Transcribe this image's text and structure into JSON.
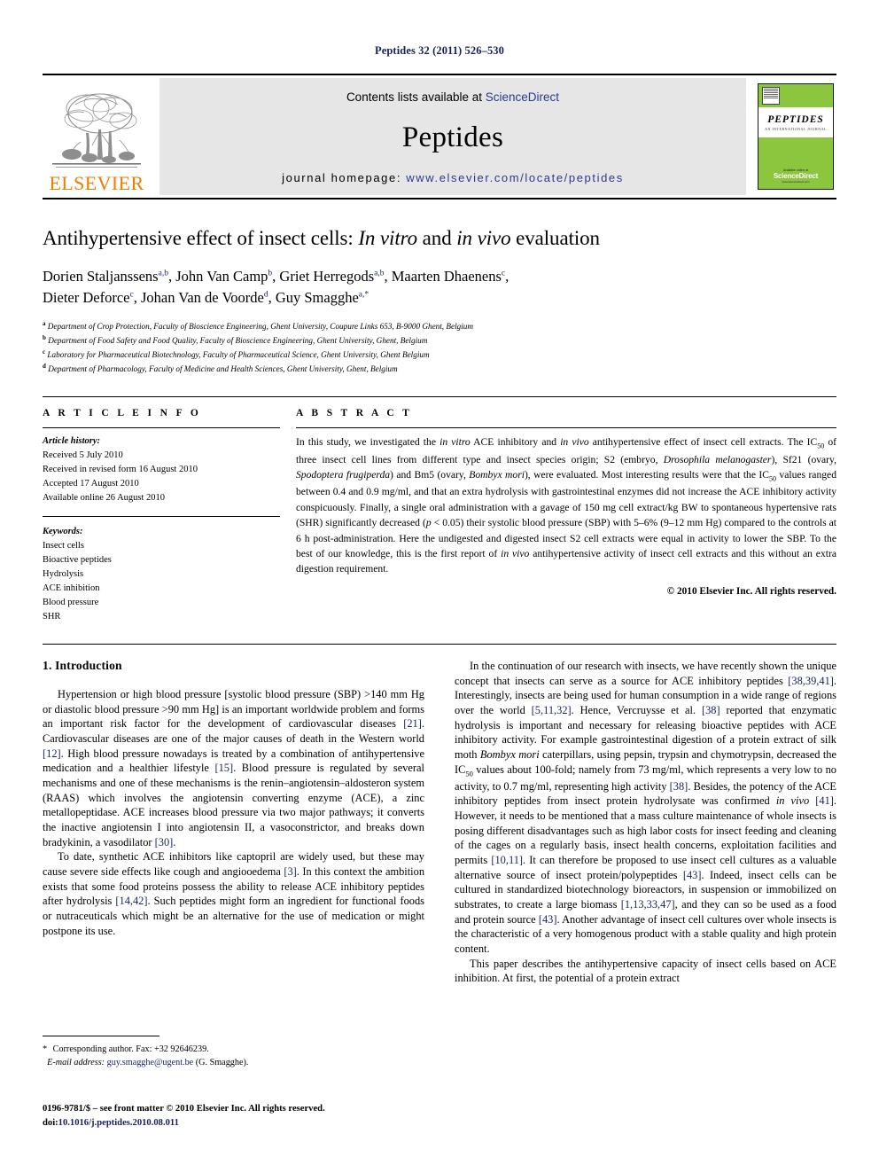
{
  "running_head": "Peptides 32 (2011) 526–530",
  "masthead": {
    "contents_prefix": "Contents lists available at ",
    "sciencedirect": "ScienceDirect",
    "journal_title": "Peptides",
    "homepage_prefix": "journal homepage: ",
    "homepage_url": "www.elsevier.com/locate/peptides",
    "publisher_wordmark": "ELSEVIER",
    "cover": {
      "name": "PEPTIDES",
      "subtitle": "AN INTERNATIONAL JOURNAL",
      "available_online": "Available online at",
      "sciencedirect": "ScienceDirect",
      "sd_tagline": "www.sciencedirect.com"
    },
    "colors": {
      "link": "#2b3a8c",
      "band": "#e6e6e6",
      "cover_green": "#8cc63e",
      "elsevier_orange": "#ef7d00"
    }
  },
  "article": {
    "title_part1": "Antihypertensive effect of insect cells: ",
    "title_italic1": "In vitro",
    "title_part2": " and ",
    "title_italic2": "in vivo",
    "title_part3": " evaluation",
    "authors_line1_a": "Dorien Staljanssens",
    "authors_line1_a_sup": "a,b",
    "authors_line1_b": ", John Van Camp",
    "authors_line1_b_sup": "b",
    "authors_line1_c": ", Griet Herregods",
    "authors_line1_c_sup": "a,b",
    "authors_line1_d": ", Maarten Dhaenens",
    "authors_line1_d_sup": "c",
    "authors_line1_end": ",",
    "authors_line2_a": "Dieter Deforce",
    "authors_line2_a_sup": "c",
    "authors_line2_b": ", Johan Van de Voorde",
    "authors_line2_b_sup": "d",
    "authors_line2_c": ", Guy Smagghe",
    "authors_line2_c_sup": "a,*",
    "affiliations": [
      {
        "mark": "a",
        "text": "Department of Crop Protection, Faculty of Bioscience Engineering, Ghent University, Coupure Links 653, B-9000 Ghent, Belgium"
      },
      {
        "mark": "b",
        "text": "Department of Food Safety and Food Quality, Faculty of Bioscience Engineering, Ghent University, Ghent, Belgium"
      },
      {
        "mark": "c",
        "text": "Laboratory for Pharmaceutical Biotechnology, Faculty of Pharmaceutical Science, Ghent University, Ghent Belgium"
      },
      {
        "mark": "d",
        "text": "Department of Pharmacology, Faculty of Medicine and Health Sciences, Ghent University, Ghent, Belgium"
      }
    ]
  },
  "info": {
    "heading": "A R T I C L E   I N F O",
    "history_label": "Article history:",
    "history": [
      "Received 5 July 2010",
      "Received in revised form 16 August 2010",
      "Accepted 17 August 2010",
      "Available online 26 August 2010"
    ],
    "keywords_label": "Keywords:",
    "keywords": [
      "Insect cells",
      "Bioactive peptides",
      "Hydrolysis",
      "ACE inhibition",
      "Blood pressure",
      "SHR"
    ]
  },
  "abstract": {
    "heading": "A B S T R A C T",
    "s1": "In this study, we investigated the ",
    "i1": "in vitro",
    "s2": " ACE inhibitory and ",
    "i2": "in vivo",
    "s3": " antihypertensive effect of insect cell extracts. The IC",
    "sub1": "50",
    "s4": " of three insect cell lines from different type and insect species origin; S2 (embryo, ",
    "i3": "Drosophila melanogaster",
    "s5": "), Sf21 (ovary, ",
    "i4": "Spodoptera frugiperda",
    "s6": ") and Bm5 (ovary, ",
    "i5": "Bombyx mori",
    "s7": "), were evaluated. Most interesting results were that the IC",
    "sub2": "50",
    "s8": " values ranged between 0.4 and 0.9 mg/ml, and that an extra hydrolysis with gastrointestinal enzymes did not increase the ACE inhibitory activity conspicuously. Finally, a single oral administration with a gavage of 150 mg cell extract/kg BW to spontaneous hypertensive rats (SHR) significantly decreased (",
    "i6": "p",
    "s9": " < 0.05) their systolic blood pressure (SBP) with 5–6% (9–12 mm Hg) compared to the controls at 6 h post-administration. Here the undigested and digested insect S2 cell extracts were equal in activity to lower the SBP. To the best of our knowledge, this is the first report of ",
    "i7": "in vivo",
    "s10": " antihypertensive activity of insect cell extracts and this without an extra digestion requirement.",
    "copyright": "© 2010 Elsevier Inc. All rights reserved."
  },
  "introduction": {
    "heading": "1.  Introduction",
    "left_p1": {
      "t1": "Hypertension or high blood pressure [systolic blood pressure (SBP) >140 mm Hg or diastolic blood pressure >90 mm Hg] is an important worldwide problem and forms an important risk factor for the development of cardiovascular diseases ",
      "r1": "[21]",
      "t2": ". Cardiovascular diseases are one of the major causes of death in the Western world ",
      "r2": "[12]",
      "t3": ". High blood pressure nowadays is treated by a combination of antihypertensive medication and a healthier lifestyle ",
      "r3": "[15]",
      "t4": ". Blood pressure is regulated by several mechanisms and one of these mechanisms is the renin–angiotensin–aldosteron system (RAAS) which involves the angiotensin converting enzyme (ACE), a zinc metallopeptidase. ACE increases blood pressure via two major pathways; it converts the inactive angiotensin I into angiotensin II, a vasoconstrictor, and breaks down bradykinin, a vasodilator ",
      "r4": "[30]",
      "t5": "."
    },
    "left_p2": {
      "t1": "To date, synthetic ACE inhibitors like captopril are widely used, but these may cause severe side effects like cough and angiooedema ",
      "r1": "[3]",
      "t2": ". In this context the ambition exists that some food proteins possess the ability to release ACE inhibitory peptides after hydrolysis ",
      "r2": "[14,42]",
      "t3": ". Such peptides might form an ingredient for functional foods or nutraceuticals which might be an alternative for the use of medication or might postpone its use."
    },
    "right_p1": {
      "t1": "In the continuation of our research with insects, we have recently shown the unique concept that insects can serve as a source for ACE inhibitory peptides ",
      "r1": "[38,39,41]",
      "t2": ". Interestingly, insects are being used for human consumption in a wide range of regions over the world ",
      "r2": "[5,11,32]",
      "t3": ". Hence, Vercruysse et al. ",
      "r3": "[38]",
      "t4": " reported that enzymatic hydrolysis is important and necessary for releasing bioactive peptides with ACE inhibitory activity. For example gastrointestinal digestion of a protein extract of silk moth ",
      "i1": "Bombyx mori",
      "t5": " caterpillars, using pepsin, trypsin and chymotrypsin, decreased the IC",
      "sub1": "50",
      "t6": " values about 100-fold; namely from 73 mg/ml, which represents a very low to no activity, to 0.7 mg/ml, representing high activity ",
      "r4": "[38]",
      "t7": ". Besides, the potency of the ACE inhibitory peptides from insect protein hydrolysate was confirmed ",
      "i2": "in vivo",
      "t8": " ",
      "r5": "[41]",
      "t9": ". However, it needs to be mentioned that a mass culture maintenance of whole insects is posing different disadvantages such as high labor costs for insect feeding and cleaning of the cages on a regularly basis, insect health concerns, exploitation facilities and permits ",
      "r6": "[10,11]",
      "t10": ". It can therefore be proposed to use insect cell cultures as a valuable alternative source of insect protein/polypeptides ",
      "r7": "[43]",
      "t11": ". Indeed, insect cells can be cultured in standardized biotechnology bioreactors, in suspension or immobilized on substrates, to create a large biomass ",
      "r8": "[1,13,33,47]",
      "t12": ", and they can so be used as a food and protein source ",
      "r9": "[43]",
      "t13": ". Another advantage of insect cell cultures over whole insects is the characteristic of a very homogenous product with a stable quality and high protein content."
    },
    "right_p2": {
      "t1": "This paper describes the antihypertensive capacity of insect cells based on ACE inhibition. At first, the potential of a protein extract"
    }
  },
  "footnote": {
    "star": "*",
    "corresponding": " Corresponding author. Fax: +32 92646239.",
    "email_label": "E-mail address:",
    "email": "guy.smagghe@ugent.be",
    "email_suffix": " (G. Smagghe)."
  },
  "footer": {
    "issn_line": "0196-9781/$ – see front matter © 2010 Elsevier Inc. All rights reserved.",
    "doi_prefix": "doi:",
    "doi": "10.1016/j.peptides.2010.08.011"
  }
}
